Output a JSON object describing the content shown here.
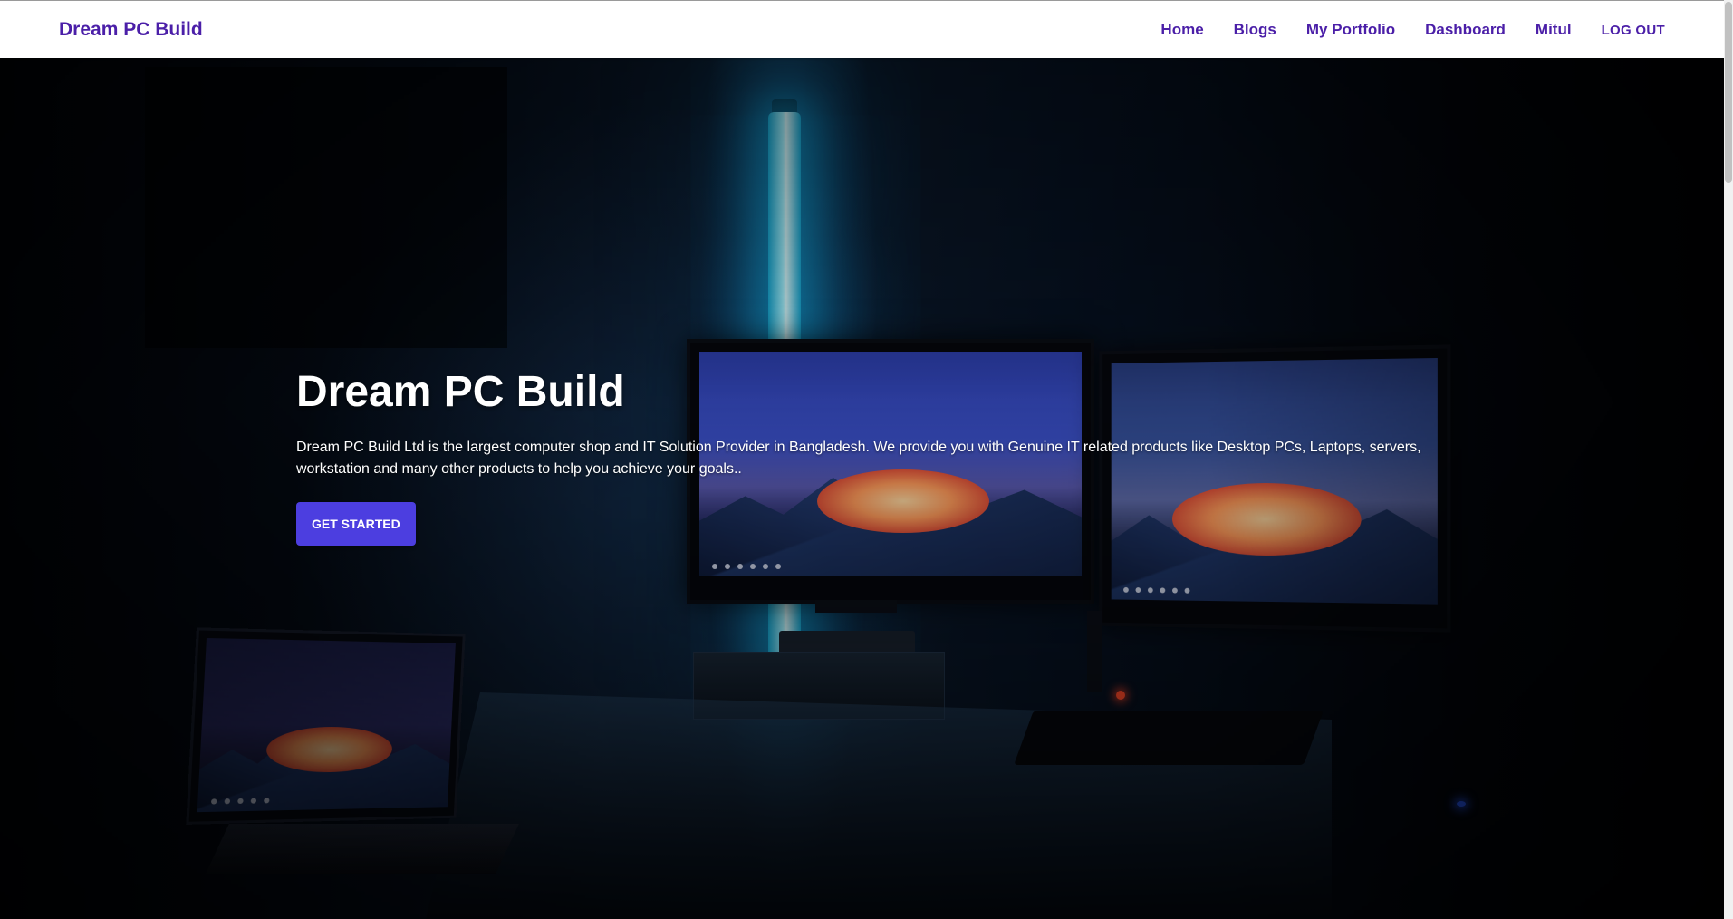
{
  "navbar": {
    "brand": "Dream PC Build",
    "links": {
      "home": "Home",
      "blogs": "Blogs",
      "portfolio": "My Portfolio",
      "dashboard": "Dashboard",
      "user": "Mitul"
    },
    "logout_label": "LOG OUT"
  },
  "hero": {
    "title": "Dream PC Build",
    "description": "Dream PC Build Ltd is the largest computer shop and IT Solution Provider in Bangladesh. We provide you with Genuine IT related products like Desktop PCs, Laptops, servers, workstation and many other products to help you achieve your goals..",
    "cta_label": "GET STARTED"
  },
  "colors": {
    "brand": "#4b1fa8",
    "cta": "#4c3ee0",
    "navbar_bg": "#ffffff"
  }
}
